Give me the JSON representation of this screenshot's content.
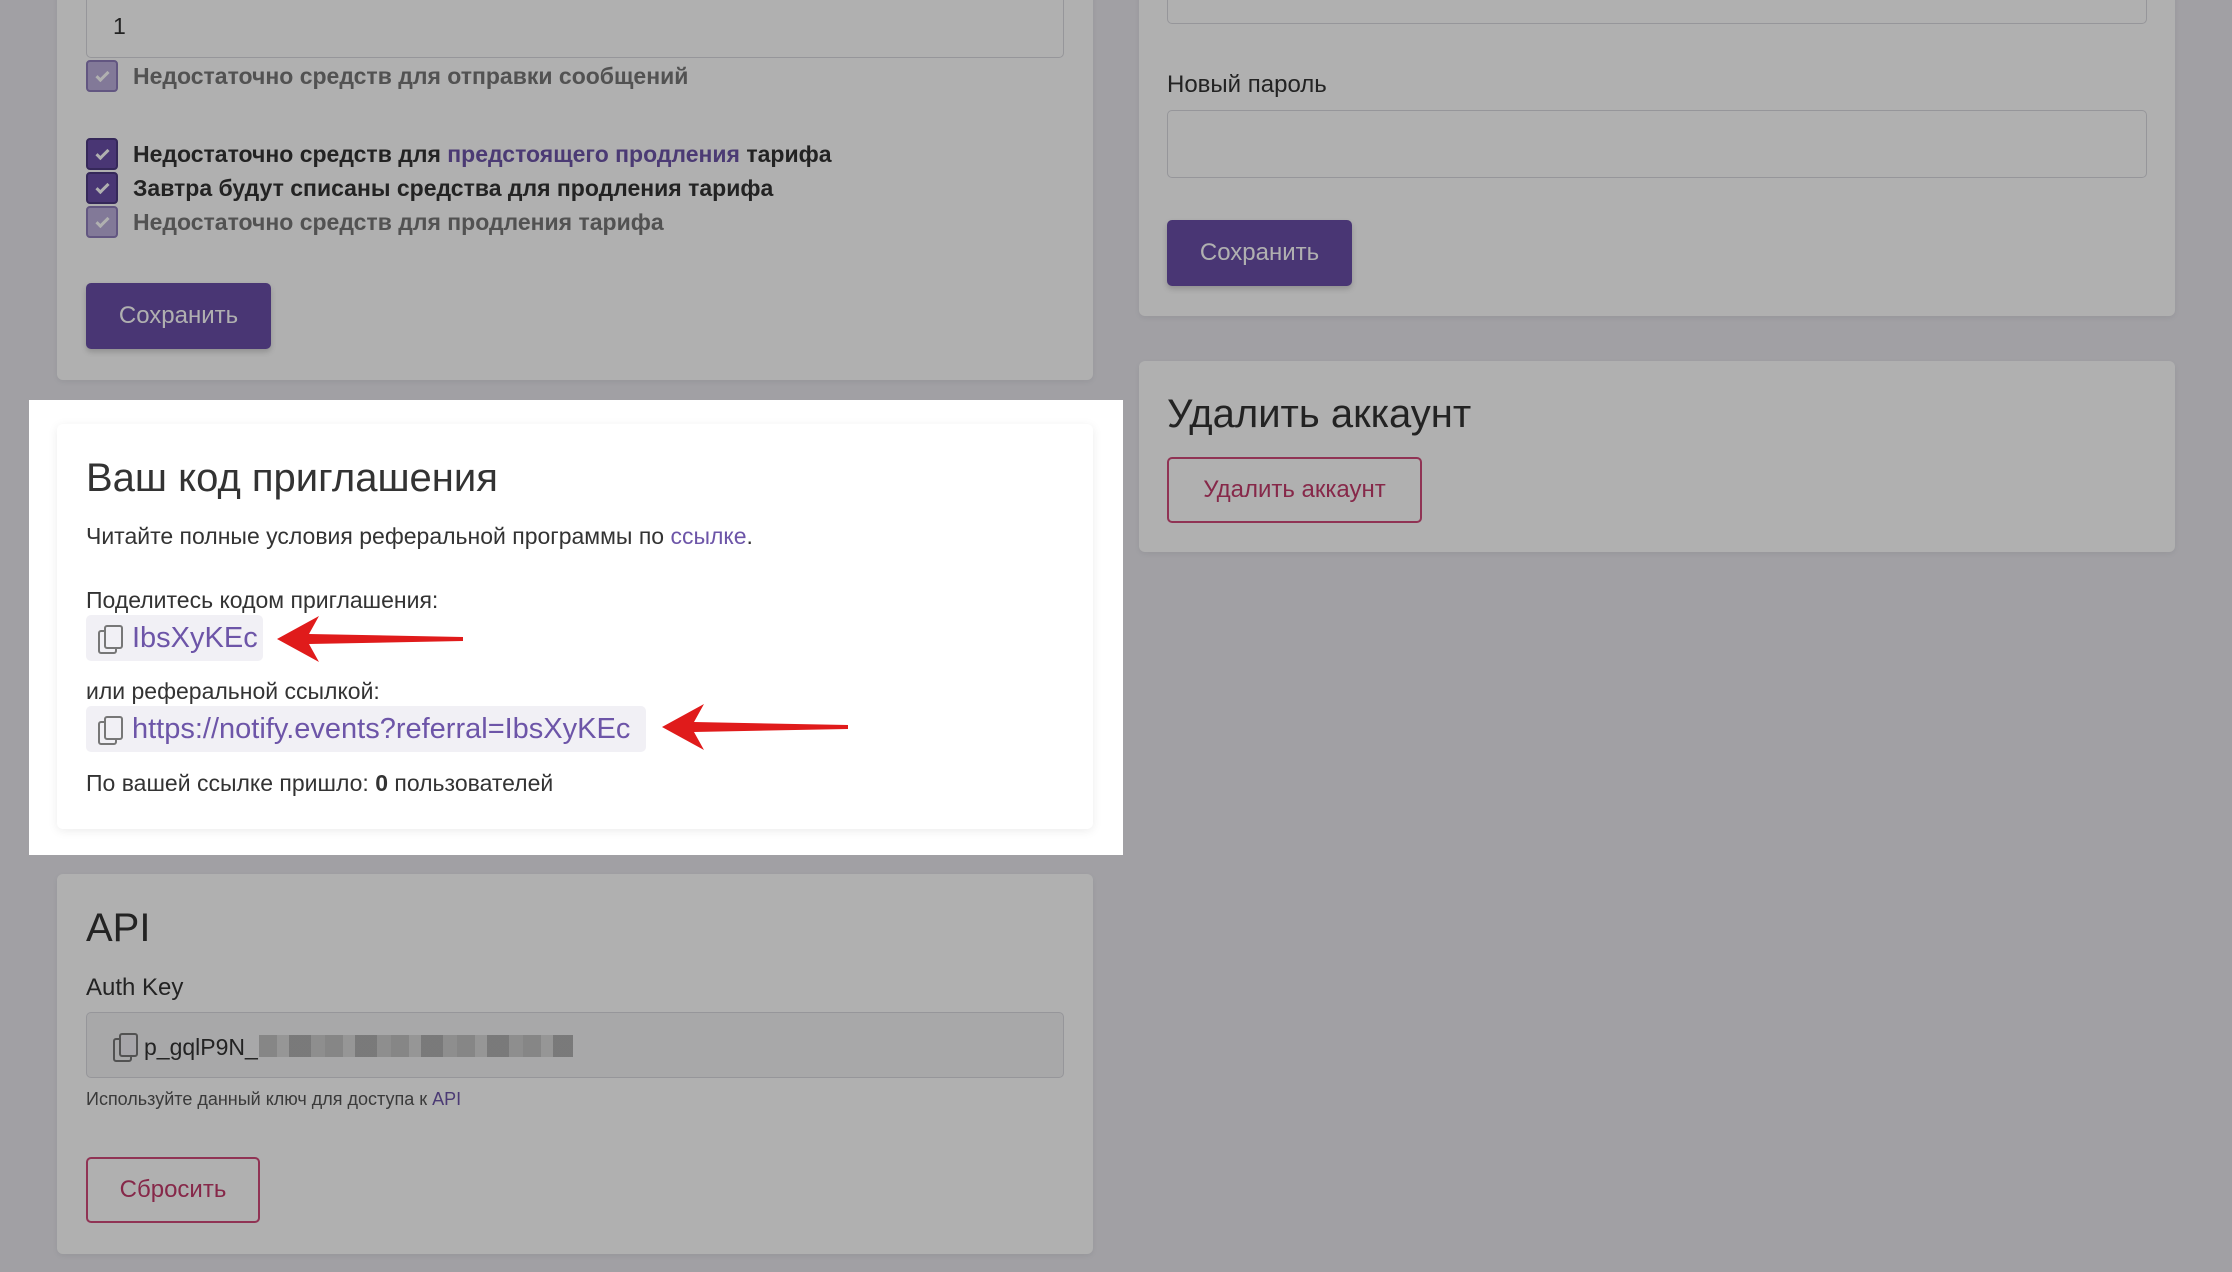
{
  "notifications": {
    "count_value": "1",
    "items": [
      {
        "label": "Недостаточно средств для отправки сообщений"
      },
      {
        "label_before": "Недостаточно средств для ",
        "label_link": "предстоящего продления",
        "label_after": " тарифа"
      },
      {
        "label": "Завтра будут списаны средства для продления тарифа"
      },
      {
        "label": "Недостаточно средств для продления тарифа"
      }
    ],
    "save_label": "Сохранить"
  },
  "password": {
    "new_password_label": "Новый пароль",
    "new_password_value": "",
    "save_label": "Сохранить"
  },
  "delete_account": {
    "title": "Удалить аккаунт",
    "button_label": "Удалить аккаунт"
  },
  "invite": {
    "title": "Ваш код приглашения",
    "terms_text": "Читайте полные условия реферальной программы по ",
    "terms_link": "ссылке",
    "terms_end": ".",
    "share_code_label": "Поделитесь кодом приглашения:",
    "code": "IbsXyKEc",
    "or_link_label": "или реферальной ссылкой:",
    "referral_url": "https://notify.events?referral=IbsXyKEc",
    "stats_before": "По вашей ссылке пришло: ",
    "stats_count": "0",
    "stats_after": " пользователей"
  },
  "api": {
    "title": "API",
    "auth_key_label": "Auth Key",
    "auth_key_visible": "p_gqlP9N_",
    "hint_text": "Используйте данный ключ для доступа к ",
    "hint_link": "API",
    "reset_label": "Сбросить"
  },
  "colors": {
    "accent": "#6a4fa8",
    "link": "#6d55a8",
    "danger": "#d14a7a",
    "arrow": "#e01b1b"
  }
}
